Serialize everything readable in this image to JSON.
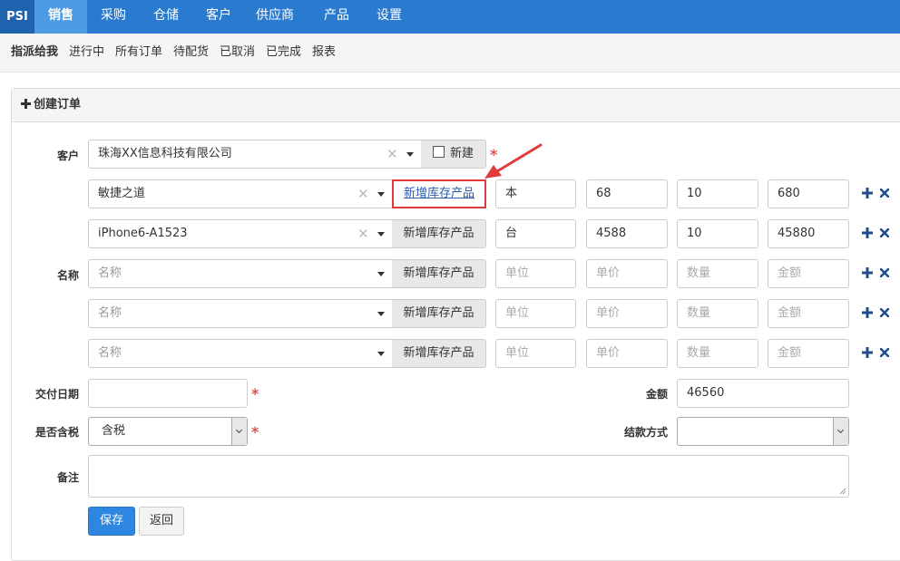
{
  "nav": {
    "brand": "PSI",
    "items": [
      {
        "label": "销售",
        "active": true
      },
      {
        "label": "采购",
        "active": false
      },
      {
        "label": "仓储",
        "active": false
      },
      {
        "label": "客户",
        "active": false
      },
      {
        "label": "供应商",
        "active": false
      },
      {
        "label": "产品",
        "active": false
      },
      {
        "label": "设置",
        "active": false
      }
    ]
  },
  "subnav": {
    "items": [
      "指派给我",
      "进行中",
      "所有订单",
      "待配货",
      "已取消",
      "已完成",
      "报表"
    ]
  },
  "panel": {
    "title": "创建订单"
  },
  "form": {
    "customer_label": "客户",
    "customer_value": "珠海XX信息科技有限公司",
    "new_checkbox_label": "新建",
    "name_label": "名称",
    "add_product_label": "新增库存产品",
    "product_placeholder": "名称",
    "unit_placeholder": "单位",
    "price_placeholder": "单价",
    "qty_placeholder": "数量",
    "amount_placeholder": "金额",
    "rows": [
      {
        "product": "敏捷之道",
        "unit": "本",
        "price": "68",
        "qty": "10",
        "amount": "680"
      },
      {
        "product": "iPhone6-A1523",
        "unit": "台",
        "price": "4588",
        "qty": "10",
        "amount": "45880"
      },
      {
        "product": "",
        "unit": "",
        "price": "",
        "qty": "",
        "amount": ""
      },
      {
        "product": "",
        "unit": "",
        "price": "",
        "qty": "",
        "amount": ""
      },
      {
        "product": "",
        "unit": "",
        "price": "",
        "qty": "",
        "amount": ""
      }
    ],
    "delivery_date_label": "交付日期",
    "delivery_date_value": "",
    "total_label": "金额",
    "total_value": "46560",
    "tax_label": "是否含税",
    "tax_value": "含税",
    "payment_label": "结款方式",
    "payment_value": "",
    "notes_label": "备注",
    "notes_value": "",
    "save_label": "保存",
    "back_label": "返回",
    "required_mark": "*"
  },
  "colors": {
    "nav_bg": "#2a7bd0",
    "nav_active": "#4d9be3",
    "required": "#d9534f",
    "highlight_border": "#e03c3c",
    "icon_blue": "#1f4e8c",
    "primary_button": "#2f86e0"
  },
  "icons": {
    "clear": "clear-x-icon",
    "caret": "caret-down-icon",
    "add_row": "plus-icon",
    "remove_row": "times-icon",
    "panel_title": "plus-icon",
    "callout": "arrow-annotation-icon"
  }
}
